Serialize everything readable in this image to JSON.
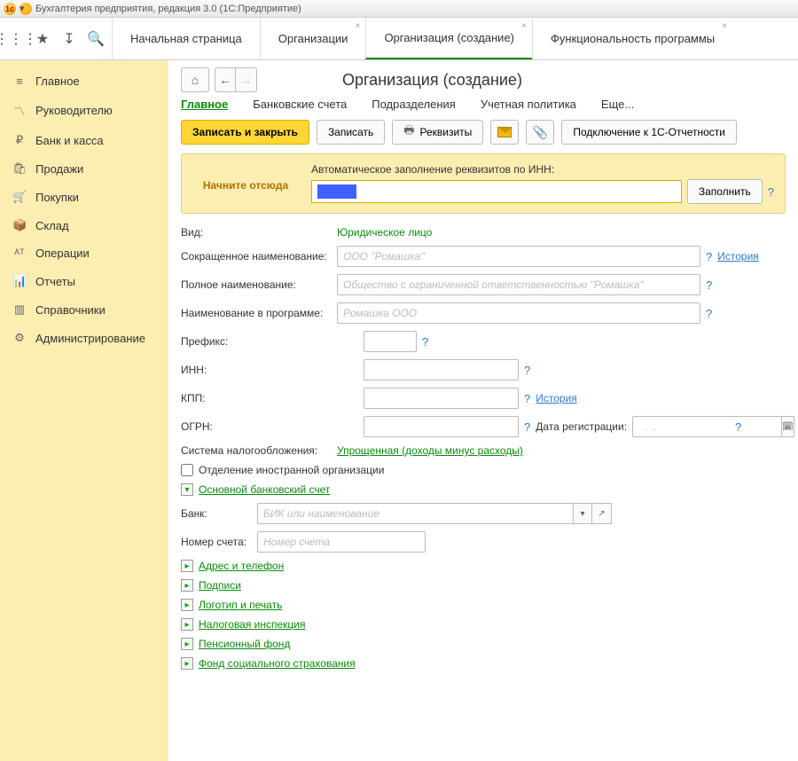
{
  "window": {
    "title": "Бухгалтерия предприятия, редакция 3.0  (1С:Предприятие)"
  },
  "tabs": {
    "start": "Начальная страница",
    "orgs": "Организации",
    "org_create": "Организация (создание)",
    "func": "Функциональность программы"
  },
  "sidebar": {
    "main": "Главное",
    "manager": "Руководителю",
    "bank": "Банк и касса",
    "sales": "Продажи",
    "purchases": "Покупки",
    "warehouse": "Склад",
    "operations": "Операции",
    "reports": "Отчеты",
    "refs": "Справочники",
    "admin": "Администрирование"
  },
  "page": {
    "title": "Организация (создание)"
  },
  "subtabs": {
    "main": "Главное",
    "bank_accounts": "Банковские счета",
    "divisions": "Подразделения",
    "policy": "Учетная политика",
    "more": "Еще..."
  },
  "actions": {
    "save_close": "Записать и закрыть",
    "save": "Записать",
    "requisites": "Реквизиты",
    "connect": "Подключение к 1С-Отчетности"
  },
  "start_here": {
    "label": "Начните отсюда",
    "hint": "Автоматическое заполнение реквизитов по ИНН:",
    "fill": "Заполнить"
  },
  "form": {
    "vid_label": "Вид:",
    "vid_value": "Юридическое лицо",
    "short_name_label": "Сокращенное наименование:",
    "short_name_ph": "ООО \"Ромашка\"",
    "full_name_label": "Полное наименование:",
    "full_name_ph": "Общество с ограниченной ответственностью \"Ромашка\"",
    "prog_name_label": "Наименование в программе:",
    "prog_name_ph": "Ромашка ООО",
    "prefix_label": "Префикс:",
    "inn_label": "ИНН:",
    "kpp_label": "КПП:",
    "ogrn_label": "ОГРН:",
    "reg_date_label": "Дата регистрации:",
    "reg_date_ph": "  .  .",
    "tax_label": "Система налогообложения:",
    "tax_value": "Упрощенная (доходы минус расходы)",
    "foreign_branch": "Отделение иностранной организации",
    "bank_section": "Основной банковский счет",
    "bank_label": "Банк:",
    "bank_ph": "БИК или наименование",
    "acct_label": "Номер счета:",
    "acct_ph": "Номер счета",
    "history": "История",
    "q": "?"
  },
  "sections": {
    "address": "Адрес и телефон",
    "signatures": "Подписи",
    "logo": "Логотип и печать",
    "tax_insp": "Налоговая инспекция",
    "pension": "Пенсионный фонд",
    "social": "Фонд социального страхования"
  }
}
